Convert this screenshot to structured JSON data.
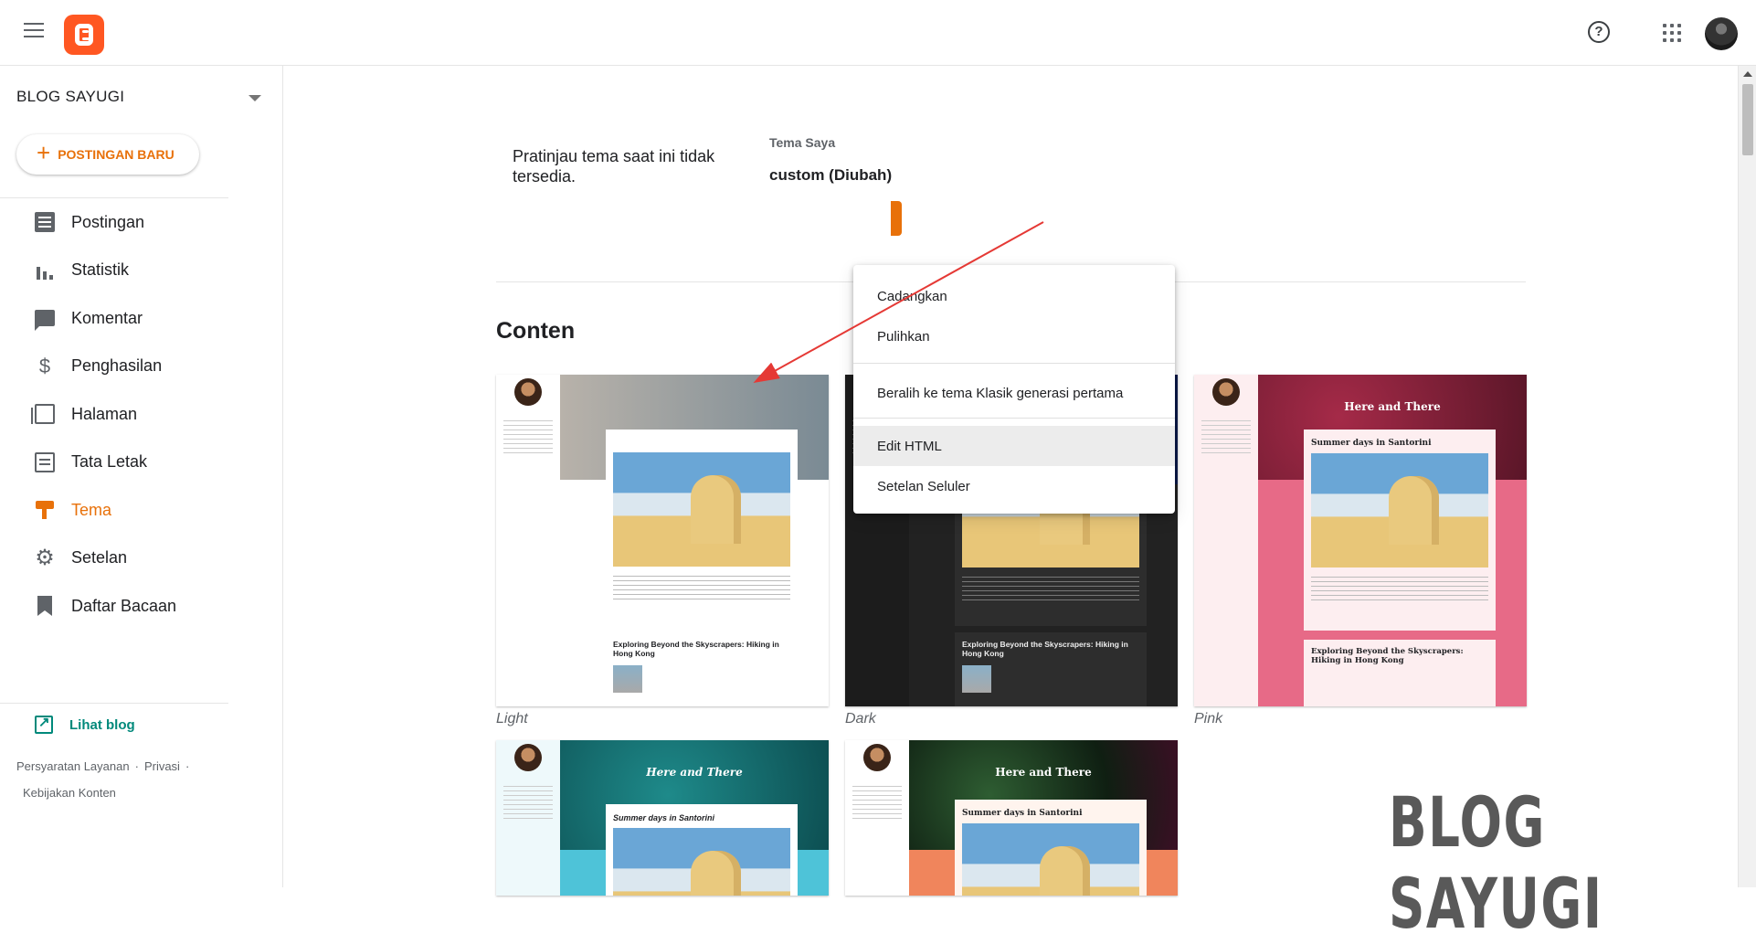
{
  "header": {
    "menu_icon": "hamburger-icon",
    "logo_icon": "blogger-logo-icon",
    "help_icon": "help-circle-icon",
    "apps_icon": "apps-grid-icon",
    "avatar_icon": "user-avatar"
  },
  "sidebar": {
    "blog_name": "BLOG SAYUGI",
    "new_post_label": "POSTINGAN BARU",
    "items": [
      {
        "label": "Postingan",
        "icon": "posts-icon"
      },
      {
        "label": "Statistik",
        "icon": "stats-icon"
      },
      {
        "label": "Komentar",
        "icon": "comment-icon"
      },
      {
        "label": "Penghasilan",
        "icon": "dollar-icon"
      },
      {
        "label": "Halaman",
        "icon": "pages-icon"
      },
      {
        "label": "Tata Letak",
        "icon": "layout-icon"
      },
      {
        "label": "Tema",
        "icon": "theme-paint-icon",
        "active": true
      },
      {
        "label": "Setelan",
        "icon": "gear-icon"
      },
      {
        "label": "Daftar Bacaan",
        "icon": "bookmark-icon"
      }
    ],
    "view_blog_label": "Lihat blog",
    "footer": {
      "terms": "Persyaratan Layanan",
      "privacy": "Privasi",
      "content_policy": "Kebijakan Konten"
    }
  },
  "main": {
    "preview_message": "Pratinjau tema saat ini tidak tersedia.",
    "my_theme_label": "Tema Saya",
    "my_theme_name": "custom (Diubah)",
    "section_title": "Conten",
    "themes": [
      {
        "label": "Light"
      },
      {
        "label": "Dark"
      },
      {
        "label": "Pink"
      },
      {
        "label": ""
      },
      {
        "label": ""
      }
    ],
    "card_texts": {
      "here_and_there": "Here and There",
      "post_title_1": "Summer days in Santorini",
      "post_title_2": "Exploring Beyond the Skyscrapers: Hiking in Hong Kong"
    }
  },
  "menu": {
    "items": [
      {
        "label": "Cadangkan"
      },
      {
        "label": "Pulihkan"
      },
      {
        "label": "Beralih ke tema Klasik generasi pertama"
      },
      {
        "label": "Edit HTML",
        "hover": true
      },
      {
        "label": "Setelan Seluler"
      }
    ]
  },
  "watermark": "BLOG SAYUGI",
  "colors": {
    "accent": "#e8710a",
    "link_teal": "#00897b",
    "arrow": "#e53935"
  }
}
